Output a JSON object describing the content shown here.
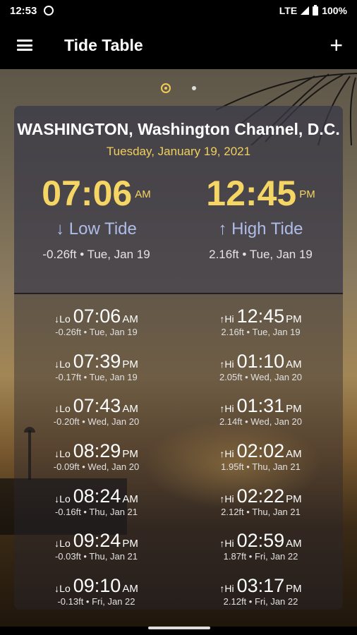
{
  "status": {
    "time": "12:53",
    "network": "LTE",
    "battery": "100%"
  },
  "app_bar": {
    "title": "Tide Table"
  },
  "card": {
    "station": "WASHINGTON, Washington Channel, D.C.",
    "date": "Tuesday, January 19, 2021",
    "current": [
      {
        "time": "07:06",
        "ampm": "AM",
        "label": "↓ Low Tide",
        "detail": "-0.26ft • Tue, Jan 19"
      },
      {
        "time": "12:45",
        "ampm": "PM",
        "label": "↑ High Tide",
        "detail": "2.16ft • Tue, Jan 19"
      }
    ],
    "rows": [
      {
        "lo": {
          "kind": "↓Lo",
          "time": "07:06",
          "ampm": "AM",
          "detail": "-0.26ft • Tue, Jan 19"
        },
        "hi": {
          "kind": "↑Hi",
          "time": "12:45",
          "ampm": "PM",
          "detail": "2.16ft • Tue, Jan 19"
        }
      },
      {
        "lo": {
          "kind": "↓Lo",
          "time": "07:39",
          "ampm": "PM",
          "detail": "-0.17ft • Tue, Jan 19"
        },
        "hi": {
          "kind": "↑Hi",
          "time": "01:10",
          "ampm": "AM",
          "detail": "2.05ft • Wed, Jan 20"
        }
      },
      {
        "lo": {
          "kind": "↓Lo",
          "time": "07:43",
          "ampm": "AM",
          "detail": "-0.20ft • Wed, Jan 20"
        },
        "hi": {
          "kind": "↑Hi",
          "time": "01:31",
          "ampm": "PM",
          "detail": "2.14ft • Wed, Jan 20"
        }
      },
      {
        "lo": {
          "kind": "↓Lo",
          "time": "08:29",
          "ampm": "PM",
          "detail": "-0.09ft • Wed, Jan 20"
        },
        "hi": {
          "kind": "↑Hi",
          "time": "02:02",
          "ampm": "AM",
          "detail": "1.95ft • Thu, Jan 21"
        }
      },
      {
        "lo": {
          "kind": "↓Lo",
          "time": "08:24",
          "ampm": "AM",
          "detail": "-0.16ft • Thu, Jan 21"
        },
        "hi": {
          "kind": "↑Hi",
          "time": "02:22",
          "ampm": "PM",
          "detail": "2.12ft • Thu, Jan 21"
        }
      },
      {
        "lo": {
          "kind": "↓Lo",
          "time": "09:24",
          "ampm": "PM",
          "detail": "-0.03ft • Thu, Jan 21"
        },
        "hi": {
          "kind": "↑Hi",
          "time": "02:59",
          "ampm": "AM",
          "detail": "1.87ft • Fri, Jan 22"
        }
      },
      {
        "lo": {
          "kind": "↓Lo",
          "time": "09:10",
          "ampm": "AM",
          "detail": "-0.13ft • Fri, Jan 22"
        },
        "hi": {
          "kind": "↑Hi",
          "time": "03:17",
          "ampm": "PM",
          "detail": "2.12ft • Fri, Jan 22"
        }
      }
    ]
  },
  "colors": {
    "accent": "#f5d564",
    "label": "#aebde8",
    "background": "#000000"
  },
  "icons": [
    "menu-icon",
    "add-icon",
    "sync-icon",
    "signal-icon",
    "battery-icon",
    "location-icon"
  ]
}
